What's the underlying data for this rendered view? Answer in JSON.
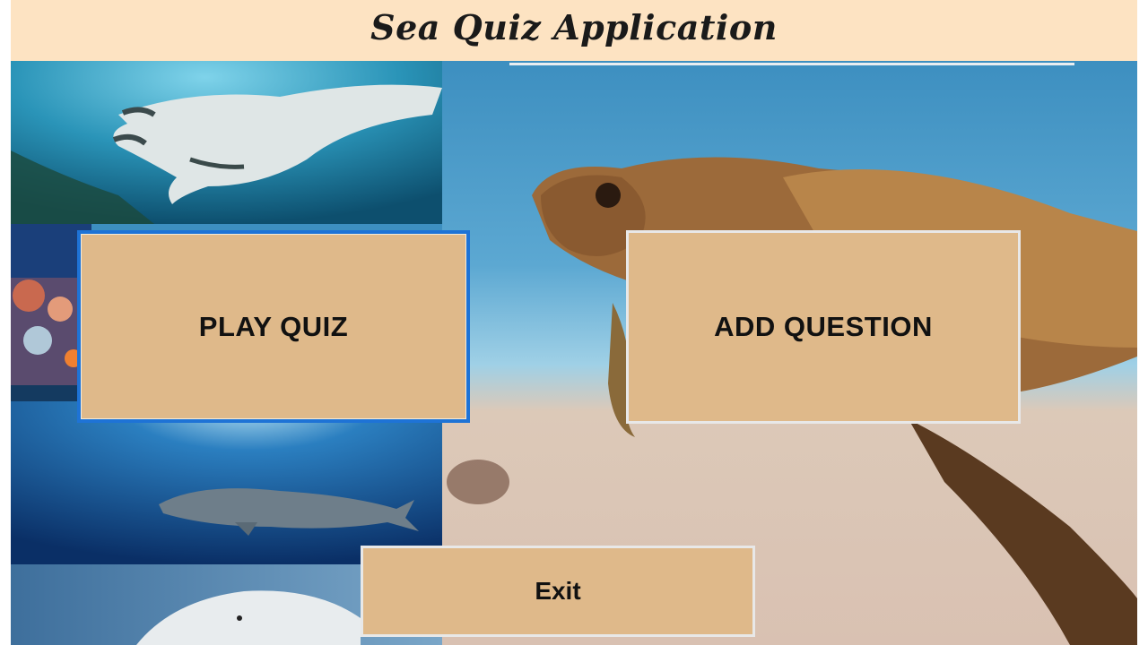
{
  "window": {
    "title": "Sea Quiz Application"
  },
  "buttons": {
    "play_quiz": "PLAY QUIZ",
    "add_question": "ADD QUESTION",
    "exit": "Exit"
  },
  "background": {
    "panels": [
      "manta-ray",
      "coral-reef",
      "whale",
      "dolphin",
      "sea-turtle"
    ]
  },
  "colors": {
    "title_bar": "#fde3c2",
    "button_fill": "#dfb98a",
    "focus_border": "#1e73d6"
  }
}
